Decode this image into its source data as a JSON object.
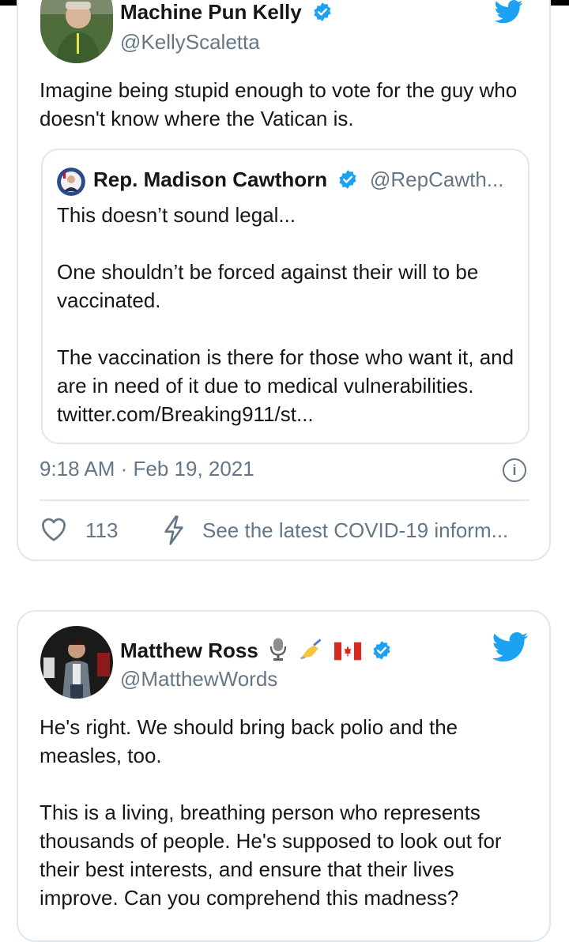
{
  "colors": {
    "twitter_blue": "#1da1f2",
    "verified_blue": "#1da1f2",
    "text_primary": "#14171a",
    "text_secondary": "#657786",
    "border": "#e1e8ed"
  },
  "tweet1": {
    "author_name": "Machine Pun Kelly",
    "author_handle": "@KellyScaletta",
    "text": "Imagine being stupid enough to vote for the guy who doesn't know where the Vatican is.",
    "quoted": {
      "author_name": "Rep. Madison Cawthorn",
      "author_handle": "@RepCawth...",
      "text": "This doesn’t sound legal...\n\nOne shouldn’t be forced against their will to be vaccinated.\n\nThe vaccination is there for those who want it, and are in need of it due to medical vulnerabilities. twitter.com/Breaking911/st..."
    },
    "timestamp": "9:18 AM · Feb 19, 2021",
    "like_count": "113",
    "covid_link": "See the latest COVID-19 inform..."
  },
  "tweet2": {
    "author_name": "Matthew Ross",
    "author_emojis": [
      "microphone-icon",
      "writing-hand-icon",
      "canada-flag-icon"
    ],
    "author_handle": "@MatthewWords",
    "text": "He's right. We should bring back polio and the measles, too.\n\nThis is a living, breathing person who represents thousands of people. He's supposed to look out for their best interests, and ensure that their lives improve. Can you comprehend this madness?"
  }
}
